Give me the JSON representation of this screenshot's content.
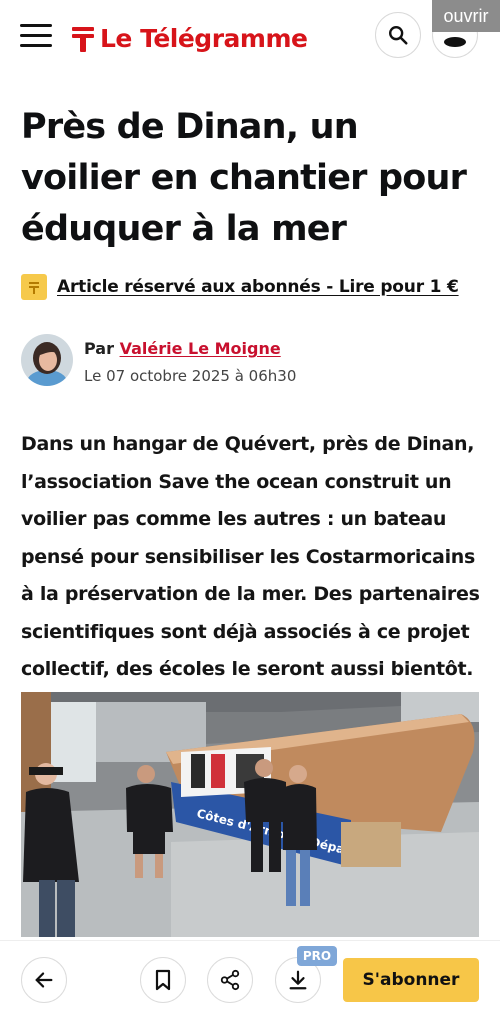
{
  "header": {
    "brand": "Le Télégramme",
    "overlay_button": "ouvrir",
    "brand_color": "#d7141a"
  },
  "article": {
    "title": "Près de Dinan, un voilier en chantier pour éduquer à la mer",
    "premium_text": "Article réservé aux abonnés - Lire pour 1 €",
    "author_prefix": "Par",
    "author_name": "Valérie Le Moigne",
    "date": "Le 07 octobre 2025 à 06h30",
    "lead": "Dans un hangar de Quévert, près de Dinan, l’association Save the ocean construit un voilier pas comme les autres : un bateau pensé pour sensibiliser les Costarmoricains à la préservation de la mer. Des partenaires scientifiques sont déjà associés à ce projet collectif, des écoles le seront aussi bientôt.",
    "photo_hull_text": "Côtes d'Armor le Département"
  },
  "bottom_bar": {
    "pro_badge": "PRO",
    "subscribe_label": "S'abonner",
    "accent_color": "#f7c648"
  },
  "icons": [
    "menu-icon",
    "search-icon",
    "user-icon",
    "arrow-left-icon",
    "bookmark-icon",
    "share-icon",
    "download-icon"
  ]
}
